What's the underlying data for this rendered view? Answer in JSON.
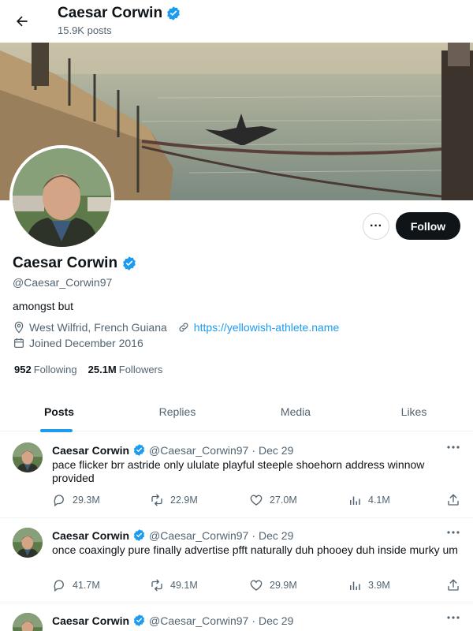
{
  "header": {
    "name": "Caesar Corwin",
    "posts_count": "15.9K posts"
  },
  "profile": {
    "display_name": "Caesar Corwin",
    "handle": "@Caesar_Corwin97",
    "bio": "amongst but",
    "location": "West Wilfrid, French Guiana",
    "website": "https://yellowish-athlete.name",
    "joined": "Joined December 2016",
    "following_count": "952",
    "following_label": "Following",
    "followers_count": "25.1M",
    "followers_label": "Followers",
    "follow_label": "Follow",
    "more_label": "···",
    "verified": true
  },
  "tabs": [
    {
      "label": "Posts",
      "active": true
    },
    {
      "label": "Replies",
      "active": false
    },
    {
      "label": "Media",
      "active": false
    },
    {
      "label": "Likes",
      "active": false
    }
  ],
  "tweets": [
    {
      "name": "Caesar Corwin",
      "handle": "@Caesar_Corwin97",
      "sep": "·",
      "date": "Dec 29",
      "text": "pace flicker brr astride only ululate playful steeple shoehorn address winnow provided",
      "replies": "29.3M",
      "reposts": "22.9M",
      "likes": "27.0M",
      "views": "4.1M"
    },
    {
      "name": "Caesar Corwin",
      "handle": "@Caesar_Corwin97",
      "sep": "·",
      "date": "Dec 29",
      "text": "once coaxingly pure finally advertise pfft naturally duh phooey duh inside murky um",
      "replies": "41.7M",
      "reposts": "49.1M",
      "likes": "29.9M",
      "views": "3.9M"
    },
    {
      "name": "Caesar Corwin",
      "handle": "@Caesar_Corwin97",
      "sep": "·",
      "date": "Dec 29",
      "text": "",
      "replies": "",
      "reposts": "",
      "likes": "",
      "views": ""
    }
  ],
  "colors": {
    "accent": "#1d9bf0",
    "text_primary": "#0f1419",
    "text_secondary": "#536471",
    "follow_button_bg": "#0f1419"
  },
  "icons": {
    "back": "arrow-left-icon",
    "verified": "verified-badge-icon",
    "location": "map-pin-icon",
    "link": "link-icon",
    "calendar": "calendar-icon",
    "reply": "reply-icon",
    "repost": "repost-icon",
    "like": "heart-icon",
    "views": "views-icon",
    "share": "share-icon"
  }
}
